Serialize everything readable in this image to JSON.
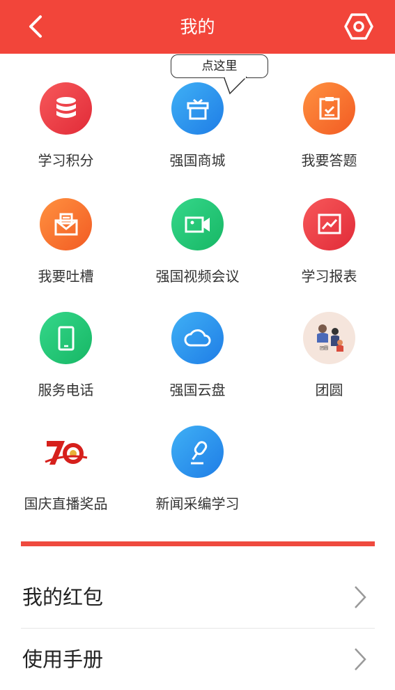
{
  "header": {
    "title": "我的",
    "back_icon": "chevron-left-icon",
    "settings_icon": "hexagon-gear-icon",
    "background": "#f2453a"
  },
  "tooltip": {
    "text": "点这里"
  },
  "grid": {
    "items": [
      {
        "label": "学习积分",
        "icon": "database-icon"
      },
      {
        "label": "强国商城",
        "icon": "gift-box-icon"
      },
      {
        "label": "我要答题",
        "icon": "clipboard-check-icon"
      },
      {
        "label": "我要吐槽",
        "icon": "envelope-icon"
      },
      {
        "label": "强国视频会议",
        "icon": "video-camera-icon"
      },
      {
        "label": "学习报表",
        "icon": "chart-trend-icon"
      },
      {
        "label": "服务电话",
        "icon": "smartphone-icon"
      },
      {
        "label": "强国云盘",
        "icon": "cloud-icon"
      },
      {
        "label": "团圆",
        "icon": "family-illustration-icon"
      },
      {
        "label": "国庆直播奖品",
        "icon": "seventy-anniversary-logo-icon"
      },
      {
        "label": "新闻采编学习",
        "icon": "microphone-icon"
      }
    ]
  },
  "list": {
    "items": [
      {
        "label": "我的红包",
        "icon": "chevron-right-icon"
      },
      {
        "label": "使用手册",
        "icon": "chevron-right-icon"
      }
    ]
  },
  "colors": {
    "accent_red": "#ef4a3e",
    "blue": "#1f7de6",
    "green": "#17b765",
    "orange": "#f25b23"
  }
}
